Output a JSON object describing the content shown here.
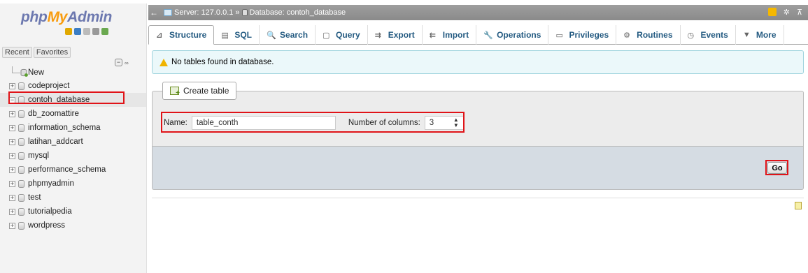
{
  "logo": {
    "php": "php",
    "my": "My",
    "admin": "Admin"
  },
  "sidebar": {
    "recent_label": "Recent",
    "favorites_label": "Favorites",
    "new_label": "New",
    "databases": [
      "codeproject",
      "contoh_database",
      "db_zoomattire",
      "information_schema",
      "latihan_addcart",
      "mysql",
      "performance_schema",
      "phpmyadmin",
      "test",
      "tutorialpedia",
      "wordpress"
    ]
  },
  "breadcrumb": {
    "server": "Server: 127.0.0.1",
    "separator": "»",
    "database": "Database: contoh_database"
  },
  "tabs": [
    {
      "label": "Structure",
      "icon": "structure-icon"
    },
    {
      "label": "SQL",
      "icon": "sql-icon"
    },
    {
      "label": "Search",
      "icon": "search-icon"
    },
    {
      "label": "Query",
      "icon": "query-icon"
    },
    {
      "label": "Export",
      "icon": "export-icon"
    },
    {
      "label": "Import",
      "icon": "import-icon"
    },
    {
      "label": "Operations",
      "icon": "operations-icon"
    },
    {
      "label": "Privileges",
      "icon": "privileges-icon"
    },
    {
      "label": "Routines",
      "icon": "routines-icon"
    },
    {
      "label": "Events",
      "icon": "events-icon"
    },
    {
      "label": "More",
      "icon": "more-icon"
    }
  ],
  "notice": {
    "text": "No tables found in database."
  },
  "create_table": {
    "legend": "Create table",
    "name_label": "Name:",
    "name_value": "table_conth",
    "columns_label": "Number of columns:",
    "columns_value": "3",
    "go_label": "Go"
  },
  "colors": {
    "highlight": "#e01318",
    "tab_text": "#235a81",
    "topbar": "#8f8f8f",
    "notice_bg": "#ebf8fa",
    "footer_bg": "#d5dce3"
  }
}
